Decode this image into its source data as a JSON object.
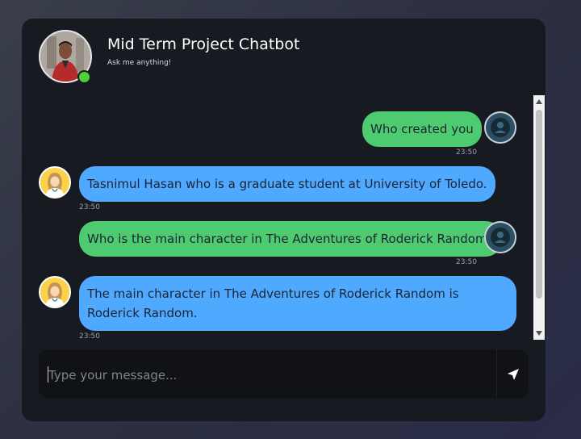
{
  "header": {
    "title": "Mid Term Project Chatbot",
    "subtitle": "Ask me anything!"
  },
  "messages": [
    {
      "sender": "user",
      "text": "Who created you",
      "time": "23:50"
    },
    {
      "sender": "bot",
      "text": "Tasnimul Hasan who is a graduate student at University of Toledo.",
      "time": "23:50"
    },
    {
      "sender": "user",
      "text": "Who is the main character in The Adventures of Roderick Random?",
      "time": "23:50"
    },
    {
      "sender": "bot",
      "text": "The main character in The Adventures of Roderick Random is Roderick Random.",
      "time": "23:50"
    }
  ],
  "input": {
    "placeholder": "Type your message...",
    "value": ""
  },
  "icons": {
    "send": "send-icon",
    "user_avatar": "user-avatar-icon",
    "bot_avatar": "bot-avatar-icon"
  },
  "colors": {
    "user_bubble": "#4ecb71",
    "bot_bubble": "#4fa9ff",
    "online": "#4cd137",
    "card": "#171a21"
  }
}
